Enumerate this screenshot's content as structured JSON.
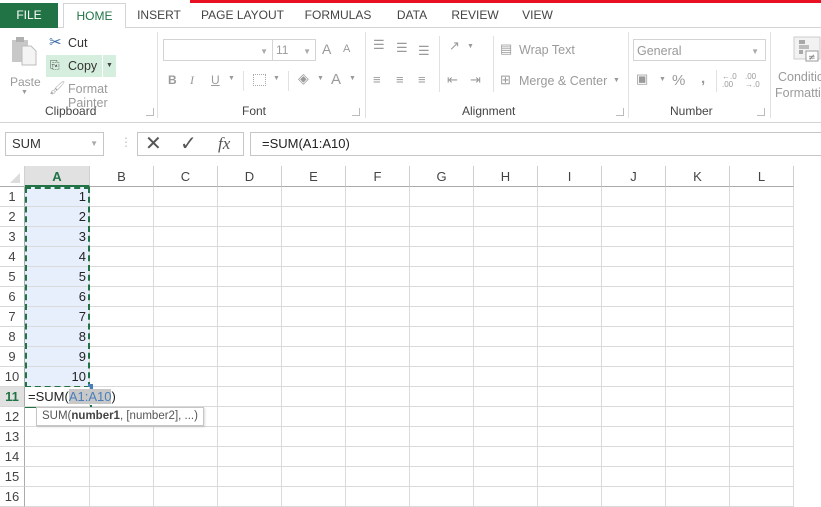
{
  "ribbon_tabs": [
    {
      "label": "FILE"
    },
    {
      "label": "HOME",
      "active": true
    },
    {
      "label": "INSERT"
    },
    {
      "label": "PAGE LAYOUT"
    },
    {
      "label": "FORMULAS"
    },
    {
      "label": "DATA"
    },
    {
      "label": "REVIEW"
    },
    {
      "label": "VIEW"
    }
  ],
  "clipboard": {
    "paste_label": "Paste",
    "cut_label": "Cut",
    "copy_label": "Copy",
    "format_painter_label": "Format Painter",
    "group_label": "Clipboard"
  },
  "font": {
    "font_name": "",
    "font_size": "11",
    "bold": "B",
    "italic": "I",
    "underline": "U",
    "font_color": "A",
    "grow": "A",
    "shrink": "A",
    "group_label": "Font"
  },
  "alignment": {
    "wrap_text_label": "Wrap Text",
    "merge_center_label": "Merge & Center",
    "group_label": "Alignment"
  },
  "number": {
    "format": "General",
    "percent": "%",
    "comma": ",",
    "inc_decimal": "←.0 .00",
    "dec_decimal": ".00 →.0",
    "group_label": "Number"
  },
  "styles": {
    "conditional_formatting_line1": "Conditio",
    "conditional_formatting_line2": "Formatti"
  },
  "formula_bar": {
    "name_box": "SUM",
    "cancel_icon": "✕",
    "enter_icon": "✓",
    "fx_label": "fx",
    "formula": "=SUM(A1:A10)"
  },
  "columns": [
    "A",
    "B",
    "C",
    "D",
    "E",
    "F",
    "G",
    "H",
    "I",
    "J",
    "K",
    "L"
  ],
  "rows": [
    "1",
    "2",
    "3",
    "4",
    "5",
    "6",
    "7",
    "8",
    "9",
    "10",
    "11",
    "12",
    "13",
    "14",
    "15",
    "16"
  ],
  "cells_A": [
    "1",
    "2",
    "3",
    "4",
    "5",
    "6",
    "7",
    "8",
    "9",
    "10"
  ],
  "editing_cell": {
    "ref": "A11",
    "prefix": "=SUM(",
    "range": "A1:A10",
    "suffix": ")"
  },
  "tooltip": {
    "func": "SUM(",
    "arg_bold": "number1",
    "rest": ", [number2], ...)"
  },
  "colors": {
    "excel_green": "#217346",
    "range_blue": "#4a7ebb",
    "selection_fill": "#e8effc",
    "title_red": "#e81123"
  }
}
